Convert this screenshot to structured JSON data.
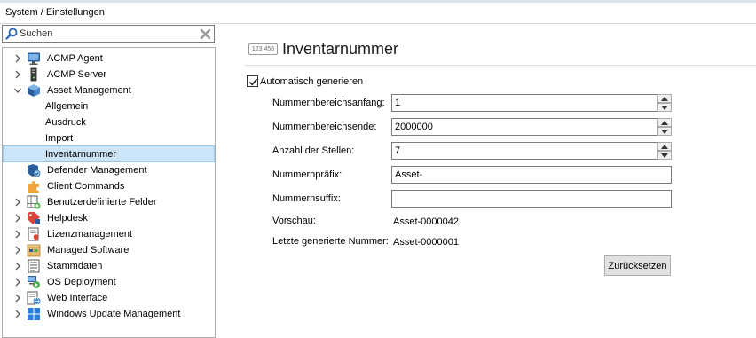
{
  "breadcrumb": "System / Einstellungen",
  "search": {
    "placeholder": "Suchen"
  },
  "tree": {
    "items": [
      {
        "label": "ACMP Agent",
        "icon": "monitor-icon",
        "expander": "collapsed"
      },
      {
        "label": "ACMP Server",
        "icon": "server-icon",
        "expander": "collapsed"
      },
      {
        "label": "Asset Management",
        "icon": "asset-cube-icon",
        "expander": "expanded"
      },
      {
        "label": "Allgemein",
        "icon": "",
        "expander": "none"
      },
      {
        "label": "Ausdruck",
        "icon": "",
        "expander": "none"
      },
      {
        "label": "Import",
        "icon": "",
        "expander": "none"
      },
      {
        "label": "Inventarnummer",
        "icon": "",
        "expander": "none",
        "selected": true
      },
      {
        "label": "Defender Management",
        "icon": "shield-icon",
        "expander": "none"
      },
      {
        "label": "Client Commands",
        "icon": "puzzle-icon",
        "expander": "none"
      },
      {
        "label": "Benutzerdefinierte Felder",
        "icon": "custom-fields-icon",
        "expander": "collapsed"
      },
      {
        "label": "Helpdesk",
        "icon": "ticket-icon",
        "expander": "collapsed"
      },
      {
        "label": "Lizenzmanagement",
        "icon": "license-icon",
        "expander": "collapsed"
      },
      {
        "label": "Managed Software",
        "icon": "software-package-icon",
        "expander": "collapsed"
      },
      {
        "label": "Stammdaten",
        "icon": "master-data-icon",
        "expander": "collapsed"
      },
      {
        "label": "OS Deployment",
        "icon": "os-deployment-icon",
        "expander": "collapsed"
      },
      {
        "label": "Web Interface",
        "icon": "web-interface-icon",
        "expander": "collapsed"
      },
      {
        "label": "Windows Update Management",
        "icon": "windows-update-icon",
        "expander": "collapsed"
      }
    ]
  },
  "page": {
    "icon_text": "123 456",
    "title": "Inventarnummer",
    "auto_generate": {
      "label": "Automatisch generieren",
      "checked": true
    },
    "fields": {
      "range_start": {
        "label": "Nummernbereichsanfang:",
        "value": "1"
      },
      "range_end": {
        "label": "Nummernbereichsende:",
        "value": "2000000"
      },
      "digits": {
        "label": "Anzahl der Stellen:",
        "value": "7"
      },
      "prefix": {
        "label": "Nummernpräfix:",
        "value": "Asset-"
      },
      "suffix": {
        "label": "Nummernsuffix:",
        "value": ""
      }
    },
    "preview": {
      "label": "Vorschau:",
      "value": "Asset-0000042"
    },
    "last_generated": {
      "label": "Letzte generierte Nummer:",
      "value": "Asset-0000001"
    },
    "reset_button": "Zurücksetzen"
  },
  "colors": {
    "selection": "#cce4f7",
    "selection_border": "#99c9ef",
    "accent": "#1f6fc5"
  }
}
